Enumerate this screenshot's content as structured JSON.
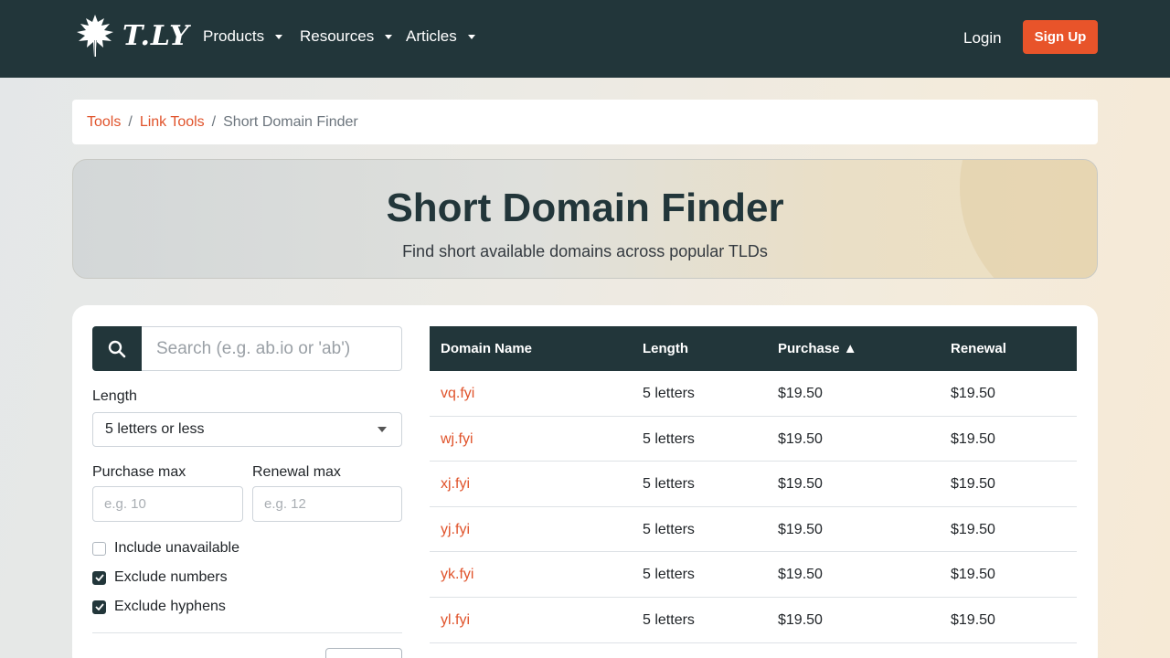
{
  "nav": {
    "brand": "T.LY",
    "items": [
      {
        "label": "Products"
      },
      {
        "label": "Resources"
      },
      {
        "label": "Articles"
      }
    ],
    "login": "Login",
    "signup": "Sign Up"
  },
  "breadcrumb": {
    "items": [
      "Tools",
      "Link Tools"
    ],
    "separator": "/",
    "current": "Short Domain Finder"
  },
  "hero": {
    "title": "Short Domain Finder",
    "subtitle": "Find short available domains across popular TLDs"
  },
  "filters": {
    "search_placeholder": "Search (e.g. ab.io or 'ab')",
    "length_label": "Length",
    "length_value": "5 letters or less",
    "purchase_label": "Purchase max",
    "purchase_placeholder": "e.g. 10",
    "renewal_label": "Renewal max",
    "renewal_placeholder": "e.g. 12",
    "checkboxes": [
      {
        "label": "Include unavailable",
        "checked": false
      },
      {
        "label": "Exclude numbers",
        "checked": true
      },
      {
        "label": "Exclude hyphens",
        "checked": true
      }
    ]
  },
  "table": {
    "headers": {
      "domain": "Domain Name",
      "length": "Length",
      "purchase": "Purchase ▲",
      "renewal": "Renewal"
    },
    "rows": [
      {
        "domain": "vq.fyi",
        "length": "5 letters",
        "purchase": "$19.50",
        "renewal": "$19.50"
      },
      {
        "domain": "wj.fyi",
        "length": "5 letters",
        "purchase": "$19.50",
        "renewal": "$19.50"
      },
      {
        "domain": "xj.fyi",
        "length": "5 letters",
        "purchase": "$19.50",
        "renewal": "$19.50"
      },
      {
        "domain": "yj.fyi",
        "length": "5 letters",
        "purchase": "$19.50",
        "renewal": "$19.50"
      },
      {
        "domain": "yk.fyi",
        "length": "5 letters",
        "purchase": "$19.50",
        "renewal": "$19.50"
      },
      {
        "domain": "yl.fyi",
        "length": "5 letters",
        "purchase": "$19.50",
        "renewal": "$19.50"
      }
    ]
  },
  "colors": {
    "navbar": "#22363a",
    "accent": "#e0532b",
    "signup": "#e8542a"
  }
}
